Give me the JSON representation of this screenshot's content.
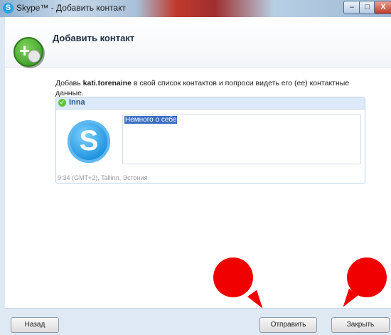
{
  "window": {
    "title": "Skype™ - Добавить контакт",
    "controls": {
      "minimize": "–",
      "maximize": "□",
      "close": "X"
    }
  },
  "header": {
    "title": "Добавить контакт",
    "icon": "add-contact-icon"
  },
  "description": {
    "prefix": "Добавь ",
    "username": "kati.torenaine",
    "suffix": " в свой список контактов и попроси видеть его (ее) контактные данные."
  },
  "contact_card": {
    "name": "Inna",
    "status": "online",
    "about_placeholder": "Немного о себе",
    "timezone": "9:34 (GMT+2), Tallinn, Эстония"
  },
  "footer": {
    "back_label": "Назад",
    "send_label": "Отправить",
    "close_label": "Закрыть"
  },
  "colors": {
    "accent": "#3a6fc4",
    "status_online": "#62c33b",
    "annotation": "#f00000"
  }
}
